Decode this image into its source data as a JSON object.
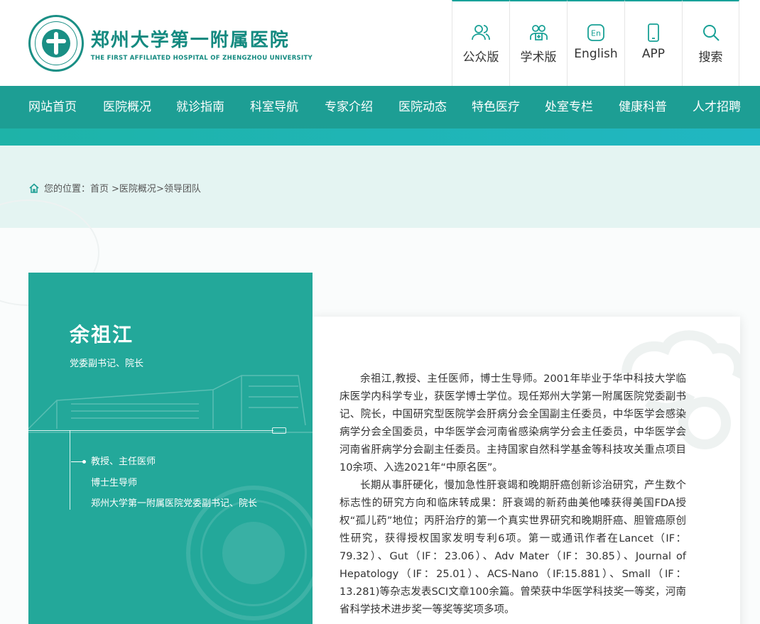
{
  "header": {
    "logo_cn": "郑州大学第一附属医院",
    "logo_en": "THE FIRST AFFILIATED HOSPITAL OF ZHENGZHOU UNIVERSITY",
    "quick_links": [
      {
        "label": "公众版",
        "icon": "users-icon"
      },
      {
        "label": "学术版",
        "icon": "doctors-icon"
      },
      {
        "label": "English",
        "icon": "en-icon"
      },
      {
        "label": "APP",
        "icon": "phone-icon"
      },
      {
        "label": "搜索",
        "icon": "search-icon"
      }
    ]
  },
  "nav": {
    "items": [
      "网站首页",
      "医院概况",
      "就诊指南",
      "科室导航",
      "专家介绍",
      "医院动态",
      "特色医疗",
      "处室专栏",
      "健康科普",
      "人才招聘"
    ]
  },
  "breadcrumb": {
    "prefix": "您的位置：",
    "path": [
      "首页",
      ">医院概况",
      ">领导团队"
    ]
  },
  "profile": {
    "name": "余祖江",
    "title": "党委副书记、院长",
    "credits": [
      "教授、主任医师",
      "博士生导师",
      "郑州大学第一附属医院党委副书记、院长"
    ]
  },
  "bio": {
    "paragraphs": [
      "余祖江,教授、主任医师，博士生导师。2001年毕业于华中科技大学临床医学内科学专业，获医学博士学位。现任郑州大学第一附属医院党委副书记、院长，中国研究型医院学会肝病分会全国副主任委员，中华医学会感染病学分会全国委员，中华医学会河南省感染病学分会主任委员，中华医学会河南省肝病学分会副主任委员。主持国家自然科学基金等科技攻关重点项目10余项、入选2021年“中原名医”。",
      "长期从事肝硬化，慢加急性肝衰竭和晚期肝癌创新诊治研究，产生数个标志性的研究方向和临床转成果：肝衰竭的新药曲美他嗪获得美国FDA授权“孤儿药”地位；丙肝治疗的第一个真实世界研究和晚期肝癌、胆管癌原创性研究，获得授权国家发明专利6项。第一或通讯作者在Lancet（IF：79.32）、Gut（IF：23.06）、Adv Mater（IF：30.85）、Journal of Hepatology（IF：25.01）、ACS-Nano（IF:15.881）、Small（IF：13.281)等杂志发表SCI文章100余篇。曾荣获中华医学科技奖一等奖，河南省科学技术进步奖一等奖等奖项多项。"
    ]
  },
  "colors": {
    "primary": "#1d9e94",
    "accent": "#20b7c2",
    "crumb_bg": "#e4f4f2",
    "profile_bg": "#23a89a"
  }
}
